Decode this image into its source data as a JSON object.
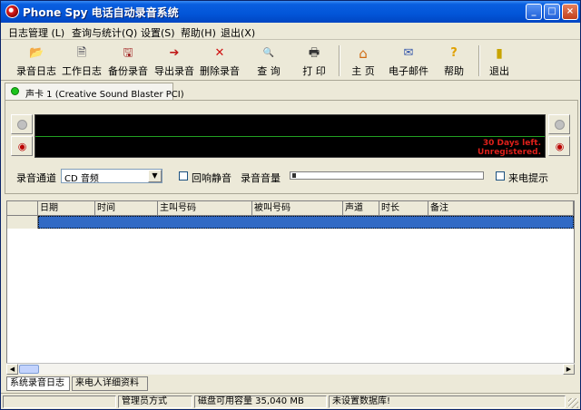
{
  "window": {
    "title": "Phone Spy 电话自动录音系统",
    "controls": {
      "minimize": "_",
      "maximize": "□",
      "close": "×"
    }
  },
  "menu": [
    "日志管理 (L)",
    "查询与统计(Q)",
    "设置(S)",
    "帮助(H)",
    "退出(X)"
  ],
  "toolbar": {
    "tools": [
      {
        "label": "录音日志",
        "icon": "folder-open-icon",
        "glyph": "📂"
      },
      {
        "label": "工作日志",
        "icon": "documents-icon",
        "glyph": "🗎"
      },
      {
        "label": "备份录音",
        "icon": "backup-icon",
        "glyph": "🖫"
      },
      {
        "label": "导出录音",
        "icon": "export-icon",
        "glyph": "➔"
      },
      {
        "label": "删除录音",
        "icon": "delete-x-icon",
        "glyph": "✕"
      },
      {
        "label": "查 询",
        "icon": "magnifier-icon",
        "glyph": "🔍"
      },
      {
        "label": "打 印",
        "icon": "printer-icon",
        "glyph": "🖶"
      },
      {
        "label": "主 页",
        "icon": "home-icon",
        "glyph": "⌂"
      },
      {
        "label": "电子邮件",
        "icon": "email-icon",
        "glyph": "✉"
      },
      {
        "label": "帮助",
        "icon": "help-icon",
        "glyph": "?"
      },
      {
        "label": "退出",
        "icon": "exit-door-icon",
        "glyph": "▮"
      }
    ]
  },
  "card_tab": {
    "label": "声卡 1 (Creative Sound Blaster PCI)",
    "status_color": "#1dc41d"
  },
  "recorder": {
    "trial_line1": "30 Days left.",
    "trial_line2": "Unregistered.",
    "channel_label": "录音通道",
    "channel_value": "CD 音频",
    "loopback_mute_label": "回响静音",
    "volume_label": "录音音量",
    "caller_alert_label": "来电提示"
  },
  "table": {
    "columns": [
      "日期",
      "时间",
      "主叫号码",
      "被叫号码",
      "声道",
      "时长",
      "备注"
    ],
    "selected_row_color": "#316ac5"
  },
  "bottom_tabs": [
    "系统录音日志",
    "来电人详细资料"
  ],
  "status": {
    "mode": "管理员方式",
    "disk": "磁盘可用容量 35,040 MB",
    "db": "未设置数据库!"
  }
}
